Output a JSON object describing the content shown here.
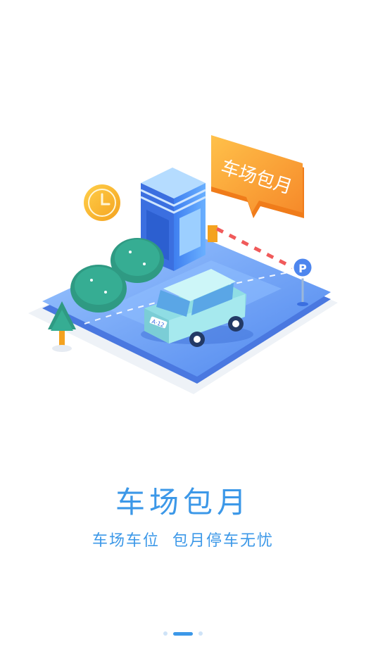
{
  "illustration": {
    "booth_sign_text": "车场包月",
    "parking_sign_letter": "P",
    "plate_text": "A·12"
  },
  "onboarding": {
    "title": "车场包月",
    "subtitle": "车场车位  包月停车无忧"
  },
  "pager": {
    "total": 3,
    "active_index": 1
  },
  "colors": {
    "accent": "#3c98e8",
    "sign_orange": "#f8a23a",
    "ground_blue": "#6ea6f6",
    "car_body": "#b6eef2",
    "bush_green": "#2f9a83"
  }
}
